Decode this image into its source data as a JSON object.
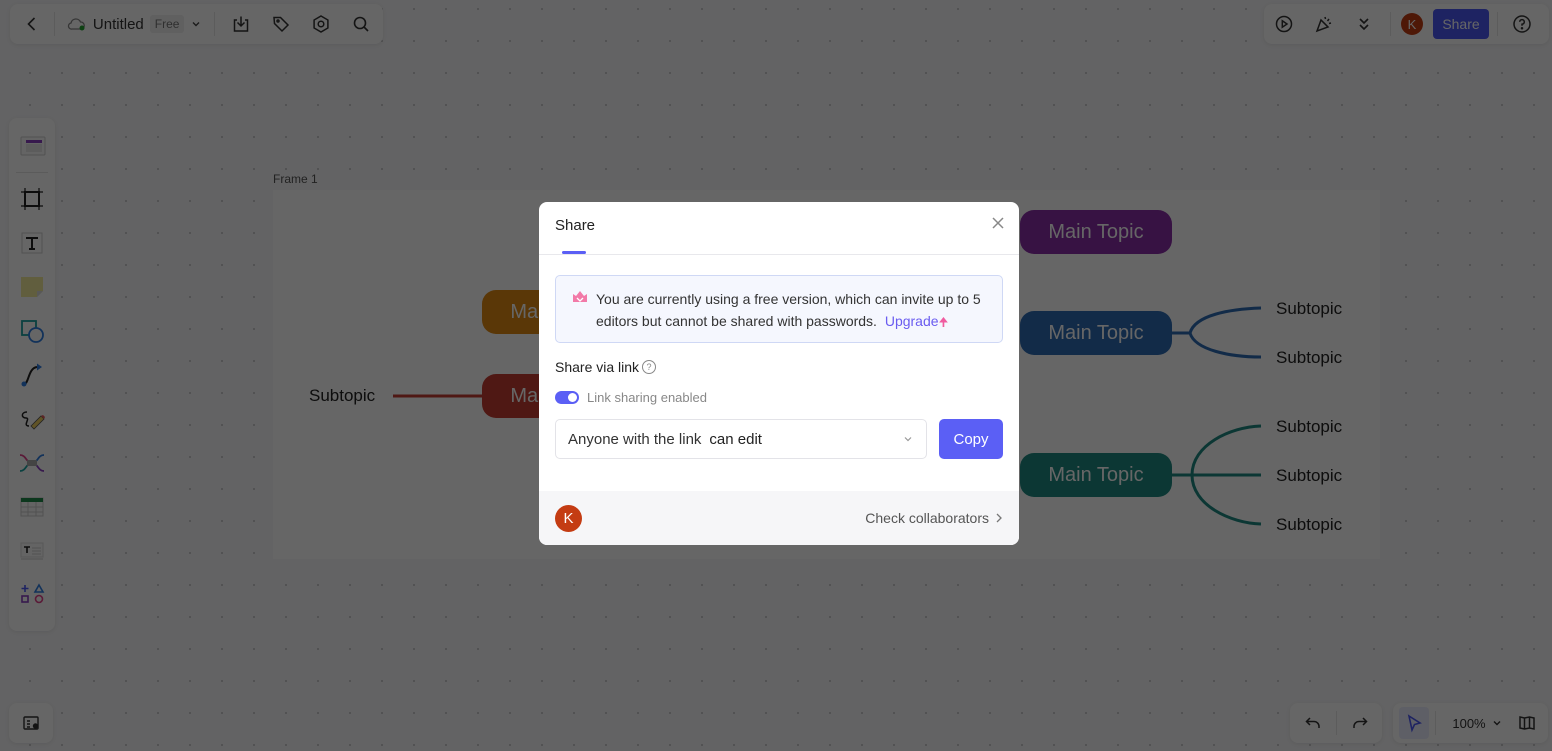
{
  "header": {
    "doc_title": "Untitled",
    "plan_badge": "Free",
    "share_button": "Share",
    "user_initial": "K"
  },
  "canvas": {
    "frame_label": "Frame 1",
    "left_topics": [
      {
        "label": "Main Topic",
        "color": "#e08a13"
      },
      {
        "label": "Main Topic",
        "color": "#c63e32"
      }
    ],
    "left_subtopic": "Subtopic",
    "right_topics": [
      {
        "label": "Main Topic",
        "color": "#8a2fa8",
        "subtopics": []
      },
      {
        "label": "Main Topic",
        "color": "#2e6cb5",
        "subtopics": [
          "Subtopic",
          "Subtopic"
        ]
      },
      {
        "label": "Main Topic",
        "color": "#1f8a83",
        "subtopics": [
          "Subtopic",
          "Subtopic",
          "Subtopic"
        ]
      }
    ]
  },
  "bottom": {
    "zoom_level": "100%"
  },
  "modal": {
    "tab_label": "Share",
    "notice_text": "You are currently using a free version, which can invite up to 5 editors but cannot be shared with passwords.",
    "upgrade_label": "Upgrade",
    "share_via_label": "Share via link",
    "toggle_label": "Link sharing enabled",
    "toggle_on": true,
    "permission_scope": "Anyone with the link",
    "permission_value": "can edit",
    "copy_label": "Copy",
    "collaborator_initial": "K",
    "check_collaborators": "Check collaborators"
  },
  "colors": {
    "accent": "#5b5ff5",
    "avatar": "#c43c13"
  }
}
